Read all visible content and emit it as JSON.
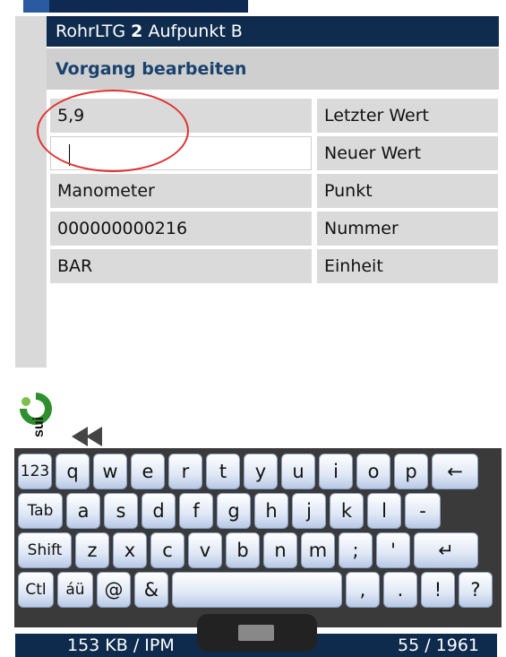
{
  "window": {
    "title_prefix": "RohrLTG ",
    "title_bold": "2",
    "title_suffix": " Aufpunkt B"
  },
  "header": {
    "subtitle": "Vorgang bearbeiten"
  },
  "fields": [
    {
      "value": "5,9",
      "label": "Letzter Wert"
    },
    {
      "value": "",
      "label": "Neuer Wert"
    },
    {
      "value": "Manometer",
      "label": "Punkt"
    },
    {
      "value": "000000000216",
      "label": "Nummer"
    },
    {
      "value": "BAR",
      "label": "Einheit"
    }
  ],
  "keyboard": {
    "row1": [
      "123",
      "q",
      "w",
      "e",
      "r",
      "t",
      "y",
      "u",
      "i",
      "o",
      "p",
      "←"
    ],
    "row2": [
      "Tab",
      "a",
      "s",
      "d",
      "f",
      "g",
      "h",
      "j",
      "k",
      "l",
      "-"
    ],
    "row3": [
      "Shift",
      "z",
      "x",
      "c",
      "v",
      "b",
      "n",
      "m",
      ";",
      "'",
      "↵"
    ],
    "row4": [
      "Ctl",
      "áü",
      "@",
      "&",
      " ",
      ",",
      ".",
      "!",
      "?"
    ]
  },
  "status": {
    "left": "153 KB   / IPM",
    "right": "55 / 1961"
  },
  "colors": {
    "titlebar": "#0f2c4e",
    "subhead_text": "#19426e",
    "annotation_circle": "#e03030"
  },
  "icons": [
    "logo-icon",
    "back-arrow-icon",
    "keyboard-icon"
  ]
}
